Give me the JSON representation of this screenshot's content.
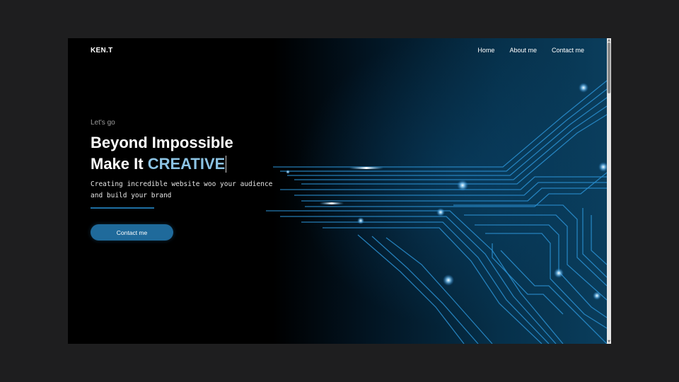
{
  "brand": {
    "logo": "KEN.T"
  },
  "nav": {
    "items": [
      {
        "label": "Home"
      },
      {
        "label": "About me"
      },
      {
        "label": "Contact me"
      }
    ]
  },
  "hero": {
    "eyebrow": "Let's go",
    "headline_line1": "Beyond Impossible",
    "headline_line2_prefix": "Make It",
    "headline_line2_accent": "CREATIVE",
    "subtext_line1": "Creating incredible website woo your audience",
    "subtext_line2": "and build your brand",
    "cta_label": "Contact me"
  },
  "colors": {
    "background": "#000000",
    "accent_text": "#8cc3e3",
    "button": "#1f6a9b",
    "circuit": "#2a8fd0"
  },
  "icons": {
    "scroll_up": "triangle-up-icon",
    "scroll_down": "triangle-down-icon"
  }
}
